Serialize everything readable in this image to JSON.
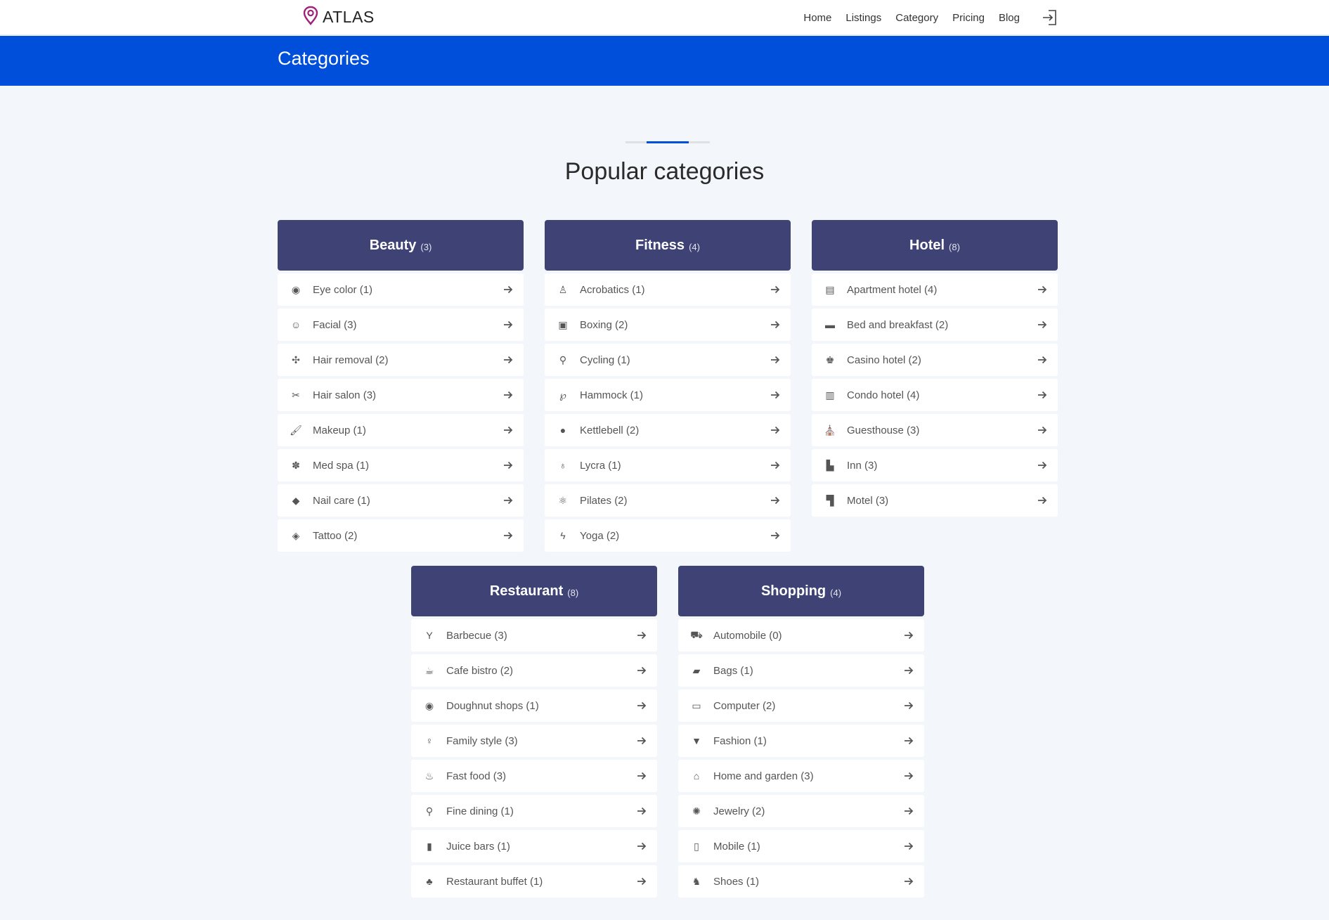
{
  "header": {
    "brand": "ATLAS",
    "nav": [
      {
        "label": "Home"
      },
      {
        "label": "Listings"
      },
      {
        "label": "Category"
      },
      {
        "label": "Pricing"
      },
      {
        "label": "Blog"
      }
    ],
    "login_icon": "sign-in-icon"
  },
  "banner": {
    "title": "Categories"
  },
  "section": {
    "title": "Popular categories"
  },
  "colors": {
    "brand_blue": "#004fdb",
    "card_header": "#3f4275",
    "logo": "#a0207a",
    "page_bg": "#f3f6fa"
  },
  "cards": [
    {
      "name": "Beauty",
      "count": "(3)",
      "items": [
        {
          "label": "Eye color (1)",
          "icon": "eye-icon"
        },
        {
          "label": "Facial (3)",
          "icon": "smile-icon"
        },
        {
          "label": "Hair removal (2)",
          "icon": "pinwheel-icon"
        },
        {
          "label": "Hair salon (3)",
          "icon": "scissors-icon"
        },
        {
          "label": "Makeup (1)",
          "icon": "brush-icon"
        },
        {
          "label": "Med spa (1)",
          "icon": "herb-icon"
        },
        {
          "label": "Nail care (1)",
          "icon": "diamond-icon"
        },
        {
          "label": "Tattoo (2)",
          "icon": "layers-icon"
        }
      ]
    },
    {
      "name": "Fitness",
      "count": "(4)",
      "items": [
        {
          "label": "Acrobatics (1)",
          "icon": "person-icon"
        },
        {
          "label": "Boxing (2)",
          "icon": "scale-icon"
        },
        {
          "label": "Cycling (1)",
          "icon": "bicycle-icon"
        },
        {
          "label": "Hammock (1)",
          "icon": "pinterest-icon"
        },
        {
          "label": "Kettlebell (2)",
          "icon": "bowling-ball-icon"
        },
        {
          "label": "Lycra (1)",
          "icon": "balloon-icon"
        },
        {
          "label": "Pilates (2)",
          "icon": "atom-icon"
        },
        {
          "label": "Yoga (2)",
          "icon": "pulse-icon"
        }
      ]
    },
    {
      "name": "Hotel",
      "count": "(8)",
      "items": [
        {
          "label": "Apartment hotel (4)",
          "icon": "building-icon"
        },
        {
          "label": "Bed and breakfast (2)",
          "icon": "bed-icon"
        },
        {
          "label": "Casino hotel (2)",
          "icon": "chess-king-icon"
        },
        {
          "label": "Condo hotel (4)",
          "icon": "hotel-icon"
        },
        {
          "label": "Guesthouse (3)",
          "icon": "place-of-worship-icon"
        },
        {
          "label": "Inn (3)",
          "icon": "industry-icon"
        },
        {
          "label": "Motel (3)",
          "icon": "hospital-icon"
        }
      ]
    },
    {
      "name": "Restaurant",
      "count": "(8)",
      "items": [
        {
          "label": "Barbecue (3)",
          "icon": "cocktail-icon"
        },
        {
          "label": "Cafe bistro (2)",
          "icon": "coffee-icon"
        },
        {
          "label": "Doughnut shops (1)",
          "icon": "dot-circle-icon"
        },
        {
          "label": "Family style (3)",
          "icon": "child-icon"
        },
        {
          "label": "Fast food (3)",
          "icon": "birthday-cake-icon"
        },
        {
          "label": "Fine dining (1)",
          "icon": "drumstick-icon"
        },
        {
          "label": "Juice bars (1)",
          "icon": "beer-mug-icon"
        },
        {
          "label": "Restaurant buffet (1)",
          "icon": "cake-icon"
        }
      ]
    },
    {
      "name": "Shopping",
      "count": "(4)",
      "items": [
        {
          "label": "Automobile (0)",
          "icon": "car-icon"
        },
        {
          "label": "Bags (1)",
          "icon": "shopping-bag-icon"
        },
        {
          "label": "Computer (2)",
          "icon": "laptop-icon"
        },
        {
          "label": "Fashion (1)",
          "icon": "tie-icon"
        },
        {
          "label": "Home and garden (3)",
          "icon": "home-icon"
        },
        {
          "label": "Jewelry (2)",
          "icon": "gem-icon"
        },
        {
          "label": "Mobile (1)",
          "icon": "mobile-icon"
        },
        {
          "label": "Shoes (1)",
          "icon": "shoe-icon"
        }
      ]
    }
  ]
}
